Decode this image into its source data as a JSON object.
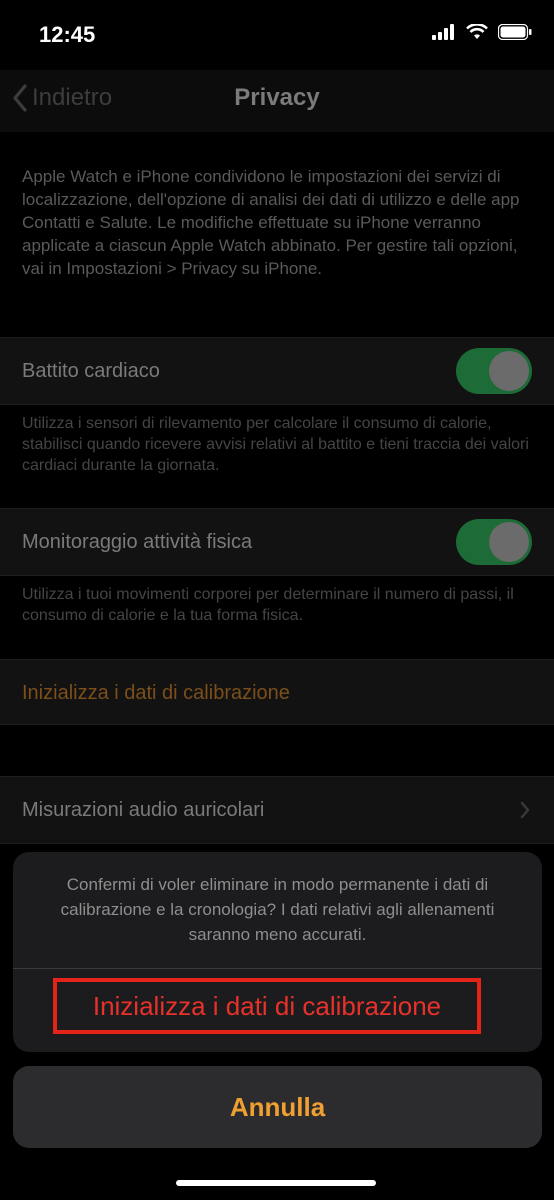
{
  "status_bar": {
    "time": "12:45"
  },
  "nav": {
    "back_label": "Indietro",
    "title": "Privacy"
  },
  "intro_text": "Apple Watch e iPhone condividono le impostazioni dei servizi di localizzazione, dell'opzione di analisi dei dati di utilizzo e delle app Contatti e Salute. Le modifiche effettuate su iPhone verranno applicate a ciascun Apple Watch abbinato. Per gestire tali opzioni, vai in Impostazioni > Privacy su iPhone.",
  "heart_rate": {
    "label": "Battito cardiaco",
    "enabled": true,
    "description": "Utilizza i sensori di rilevamento per calcolare il consumo di calorie, stabilisci quando ricevere avvisi relativi al battito e tieni traccia dei valori cardiaci durante la giornata."
  },
  "fitness": {
    "label": "Monitoraggio attività fisica",
    "enabled": true,
    "description": "Utilizza i tuoi movimenti corporei per determinare il numero di passi, il consumo di calorie e la tua forma fisica."
  },
  "reset_calibration_row": {
    "label": "Inizializza i dati di calibrazione"
  },
  "audio_row": {
    "label": "Misurazioni audio auricolari"
  },
  "action_sheet": {
    "message": "Confermi di voler eliminare in modo permanente i dati di calibrazione e la cronologia? I dati relativi agli allenamenti saranno meno accurati.",
    "destructive_label": "Inizializza i dati di calibrazione",
    "cancel_label": "Annulla"
  },
  "colors": {
    "accent_orange": "#f0a030",
    "destructive_red": "#e8312a",
    "toggle_green": "#1d6b36"
  }
}
